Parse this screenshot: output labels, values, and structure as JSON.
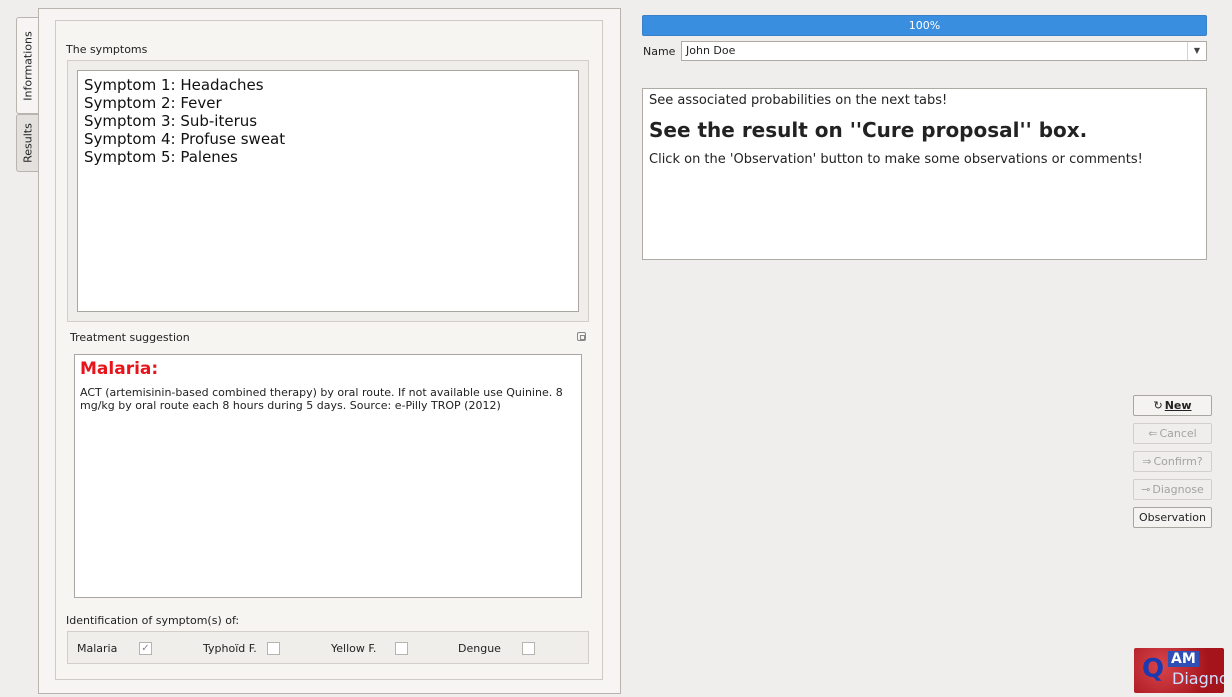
{
  "tabs": [
    {
      "label": "Informations",
      "active": true
    },
    {
      "label": "Results",
      "active": false
    }
  ],
  "symptoms": {
    "title": "The symptoms",
    "items": [
      "Symptom 1: Headaches",
      "Symptom 2: Fever",
      "Symptom 3: Sub-iterus",
      "Symptom 4: Profuse sweat",
      "Symptom 5: Palenes"
    ]
  },
  "treatment": {
    "title": "Treatment suggestion",
    "disease": "Malaria:",
    "disease_color": "#e8141b",
    "text": "ACT (artemisinin-based combined therapy) by oral route. If not available use Quinine. 8 mg/kg by oral route each 8 hours during 5 days. Source: e-Pilly TROP (2012)"
  },
  "identification": {
    "title": "Identification of symptom(s) of:",
    "items": [
      {
        "label": "Malaria",
        "checked": true
      },
      {
        "label": "Typhoïd F.",
        "checked": false
      },
      {
        "label": "Yellow F.",
        "checked": false
      },
      {
        "label": "Dengue",
        "checked": false
      }
    ]
  },
  "progress": {
    "value": 100,
    "label": "100%",
    "color": "#3a8ee0"
  },
  "name_field": {
    "label": "Name",
    "value": "John Doe"
  },
  "info": {
    "line1": "See associated probabilities on the next tabs!",
    "line2": "See the result on ''Cure proposal'' box.",
    "line3": "Click on the 'Observation' button to make some observations or comments!"
  },
  "buttons": [
    {
      "label": "New",
      "icon": "new-icon",
      "enabled": true
    },
    {
      "label": "Cancel",
      "icon": "cancel-icon",
      "enabled": false
    },
    {
      "label": "Confirm?",
      "icon": "confirm-icon",
      "enabled": false
    },
    {
      "label": "Diagnose",
      "icon": "key-icon",
      "enabled": false
    },
    {
      "label": "Observation",
      "icon": "",
      "enabled": true
    }
  ],
  "logo": {
    "top": "AM",
    "bottom": "Diagnos"
  }
}
